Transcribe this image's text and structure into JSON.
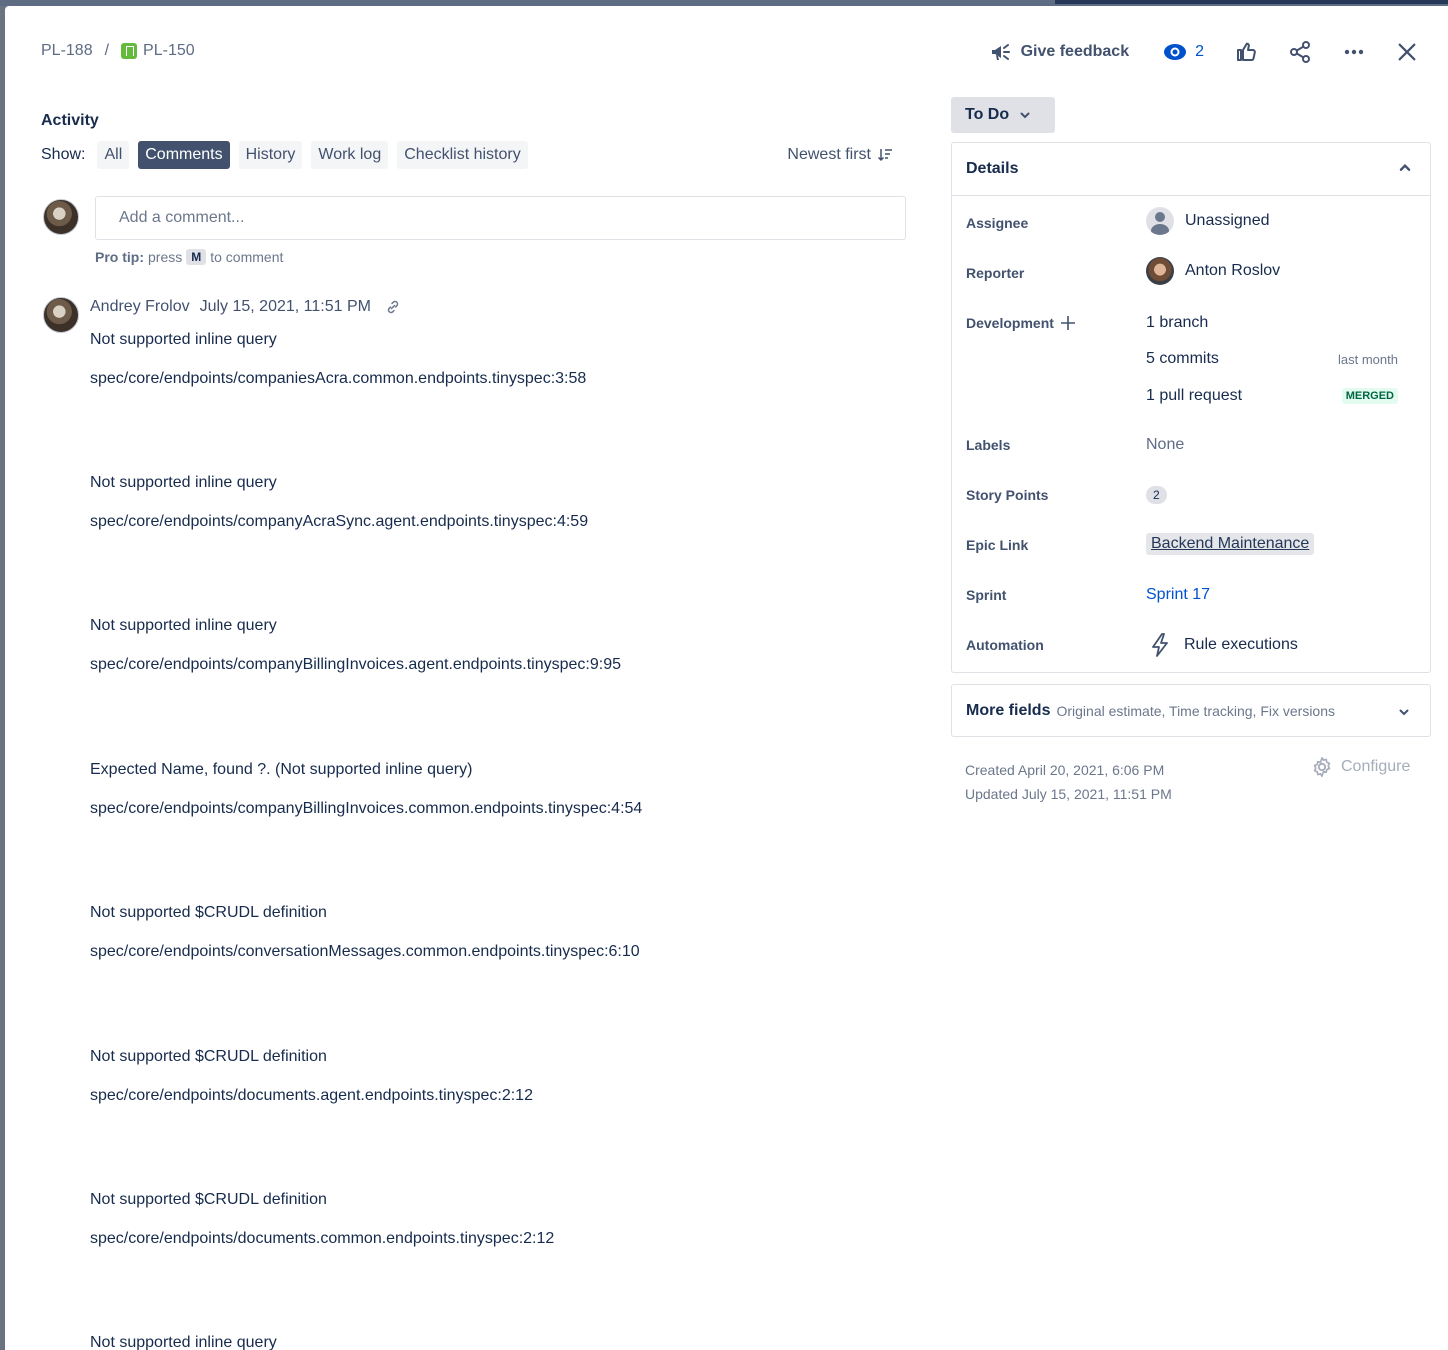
{
  "breadcrumb": {
    "parent": "PL-188",
    "separator": "/",
    "current": "PL-150"
  },
  "toolbar": {
    "feedback_label": "Give feedback",
    "watch_count": "2"
  },
  "activity": {
    "title": "Activity",
    "show_label": "Show:",
    "filters": [
      "All",
      "Comments",
      "History",
      "Work log",
      "Checklist history"
    ],
    "active_filter": "Comments",
    "sort_label": "Newest first"
  },
  "comment_input": {
    "placeholder": "Add a comment...",
    "pro_tip_label": "Pro tip:",
    "pro_tip_press": "press",
    "pro_tip_key": "M",
    "pro_tip_suffix": "to comment"
  },
  "comment": {
    "author": "Andrey Frolov",
    "date": "July 15, 2021, 11:51 PM",
    "lines": [
      "Not supported inline query",
      "spec/core/endpoints/companiesAcra.common.endpoints.tinyspec:3:58",
      "Not supported inline query",
      "spec/core/endpoints/companyAcraSync.agent.endpoints.tinyspec:4:59",
      "Not supported inline query",
      "spec/core/endpoints/companyBillingInvoices.agent.endpoints.tinyspec:9:95",
      "Expected Name, found ?. (Not supported inline query)",
      "spec/core/endpoints/companyBillingInvoices.common.endpoints.tinyspec:4:54",
      "Not supported $CRUDL definition",
      "spec/core/endpoints/conversationMessages.common.endpoints.tinyspec:6:10",
      "Not supported $CRUDL definition",
      "spec/core/endpoints/documents.agent.endpoints.tinyspec:2:12",
      "Not supported $CRUDL definition",
      "spec/core/endpoints/documents.common.endpoints.tinyspec:2:12",
      "Not supported inline query"
    ]
  },
  "status": {
    "label": "To Do"
  },
  "details": {
    "title": "Details",
    "assignee_label": "Assignee",
    "assignee_value": "Unassigned",
    "reporter_label": "Reporter",
    "reporter_value": "Anton Roslov",
    "development_label": "Development",
    "dev_branch": "1 branch",
    "dev_commits": "5 commits",
    "dev_commits_meta": "last month",
    "dev_pr": "1 pull request",
    "dev_pr_status": "MERGED",
    "labels_label": "Labels",
    "labels_value": "None",
    "story_points_label": "Story Points",
    "story_points_value": "2",
    "epic_label": "Epic Link",
    "epic_value": "Backend Maintenance",
    "sprint_label": "Sprint",
    "sprint_value": "Sprint 17",
    "automation_label": "Automation",
    "automation_value": "Rule executions"
  },
  "more_fields": {
    "title": "More fields",
    "subtitle": "Original estimate, Time tracking, Fix versions"
  },
  "meta": {
    "created": "Created April 20, 2021, 6:06 PM",
    "updated": "Updated July 15, 2021, 11:51 PM",
    "configure_label": "Configure"
  },
  "colors": {
    "link": "#0052cc",
    "active_filter_bg": "#42526e",
    "merged_green": "#006644",
    "story_green": "#63ba3c"
  },
  "icons": [
    "megaphone-icon",
    "eye-icon",
    "thumbs-up-icon",
    "share-icon",
    "more-icon",
    "close-icon",
    "sort-icon",
    "link-icon",
    "chevron-down-icon",
    "chevron-up-icon",
    "plus-icon",
    "lightning-icon",
    "gear-icon"
  ]
}
